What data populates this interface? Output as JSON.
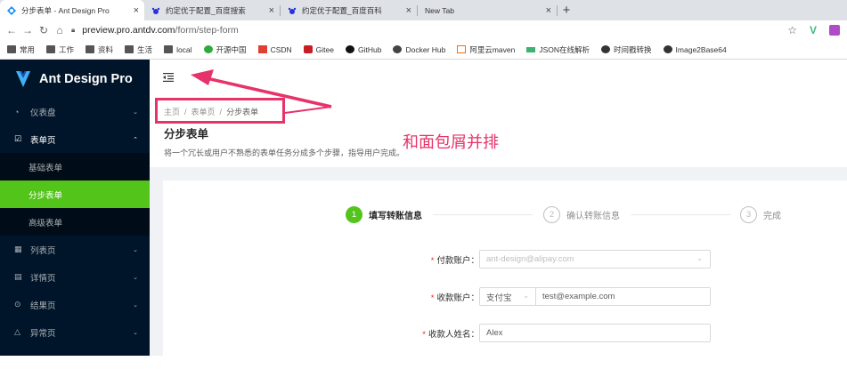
{
  "browser": {
    "tabs": [
      {
        "title": "分步表单 - Ant Design Pro",
        "active": true
      },
      {
        "title": "约定优于配置_百度搜索",
        "active": false
      },
      {
        "title": "约定优于配置_百度百科",
        "active": false
      },
      {
        "title": "New Tab",
        "active": false
      }
    ],
    "url_host": "preview.pro.antdv.com",
    "url_path": "/form/step-form",
    "bookmarks": [
      "常用",
      "工作",
      "资料",
      "生活",
      "local",
      "开源中国",
      "CSDN",
      "Gitee",
      "GitHub",
      "Docker Hub",
      "阿里云maven",
      "JSON在线解析",
      "时间戳转换",
      "Image2Base64"
    ]
  },
  "app": {
    "logo": "Ant Design Pro",
    "menu": [
      {
        "label": "仪表盘",
        "icon": "dashboard-icon"
      },
      {
        "label": "表单页",
        "icon": "form-icon",
        "open": true,
        "children": [
          {
            "label": "基础表单"
          },
          {
            "label": "分步表单",
            "selected": true
          },
          {
            "label": "高级表单"
          }
        ]
      },
      {
        "label": "列表页",
        "icon": "table-icon"
      },
      {
        "label": "详情页",
        "icon": "profile-icon"
      },
      {
        "label": "结果页",
        "icon": "check-circle-icon"
      },
      {
        "label": "异常页",
        "icon": "warning-icon"
      }
    ],
    "breadcrumb": [
      "主页",
      "表单页",
      "分步表单"
    ],
    "page_title": "分步表单",
    "page_desc": "将一个冗长或用户不熟悉的表单任务分成多个步骤，指导用户完成。",
    "steps": [
      {
        "num": "1",
        "label": "填写转账信息",
        "status": "active"
      },
      {
        "num": "2",
        "label": "确认转账信息",
        "status": "wait"
      },
      {
        "num": "3",
        "label": "完成",
        "status": "wait"
      }
    ],
    "form": {
      "pay_account_label": "付款账户：",
      "pay_account_value": "ant-design@alipay.com",
      "receiver_account_label": "收款账户：",
      "receiver_type": "支付宝",
      "receiver_account_value": "test@example.com",
      "receiver_name_label": "收款人姓名：",
      "receiver_name_value": "Alex"
    }
  },
  "annotation": {
    "text": "和面包屑并排",
    "color": "#e6336a"
  },
  "colors": {
    "sider": "#001529",
    "selected": "#52c41a"
  }
}
